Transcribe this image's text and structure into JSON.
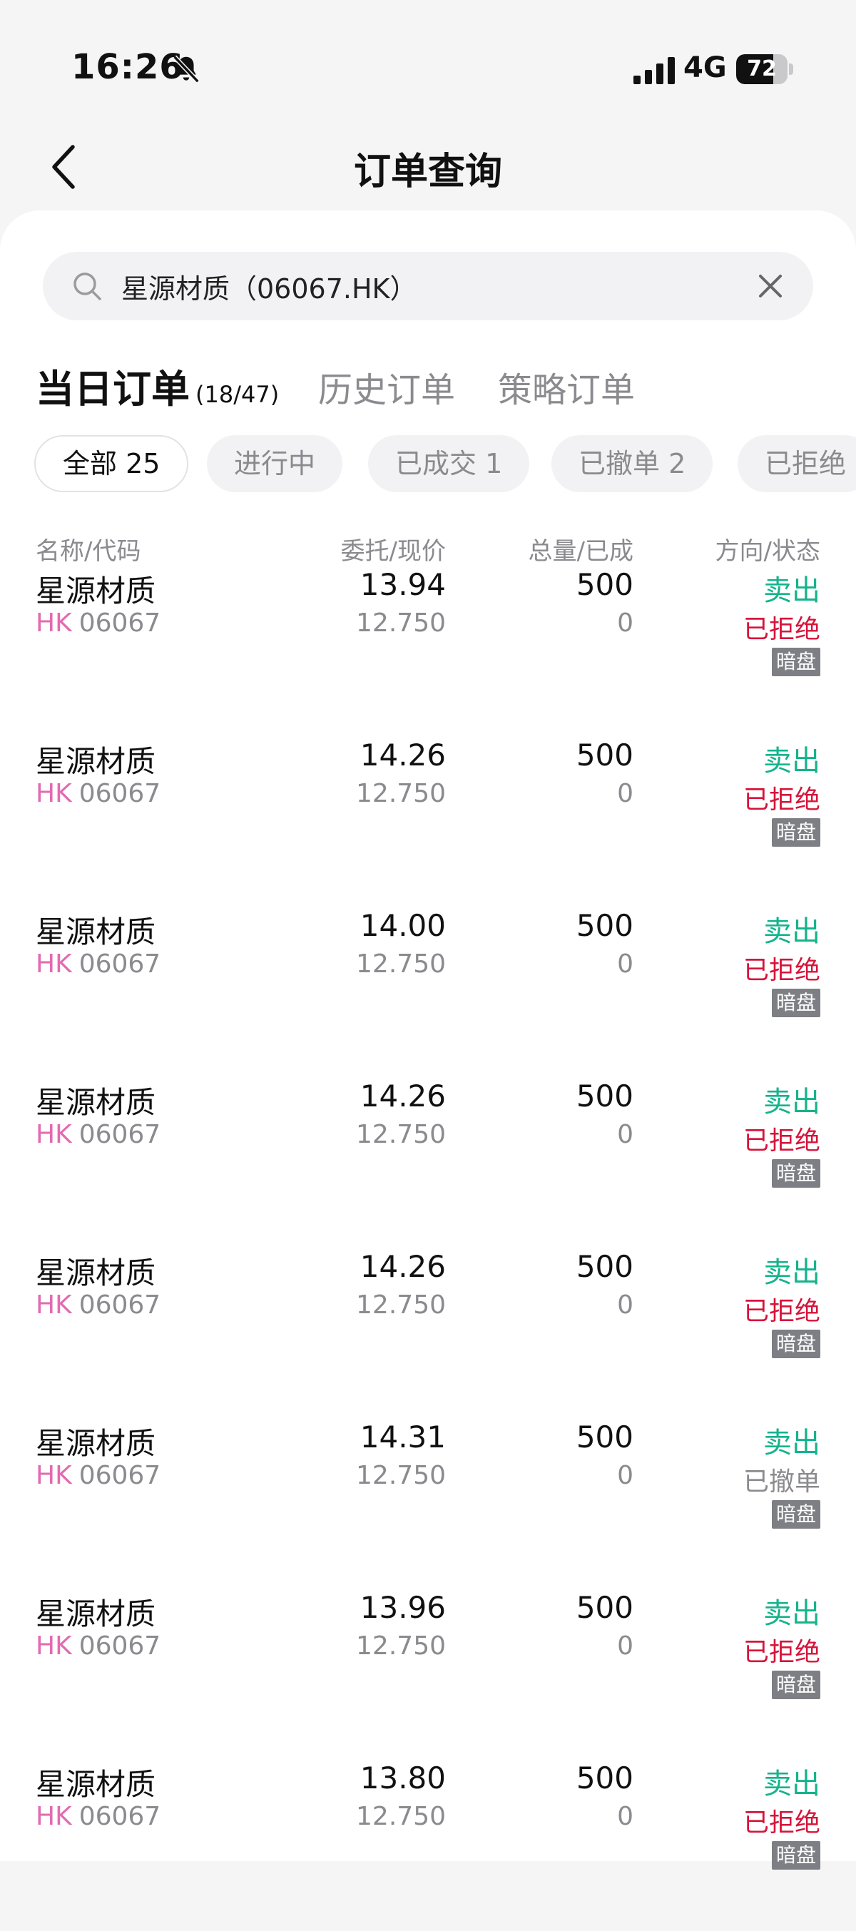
{
  "status_bar": {
    "time": "16:26",
    "network": "4G",
    "battery_level": 72,
    "battery_text": "72"
  },
  "nav": {
    "title": "订单查询"
  },
  "search": {
    "value": "星源材质（06067.HK）"
  },
  "tabs": [
    {
      "label": "当日订单",
      "count": "(18/47)",
      "active": true
    },
    {
      "label": "历史订单",
      "active": false
    },
    {
      "label": "策略订单",
      "active": false
    }
  ],
  "filters": [
    {
      "label": "全部 25",
      "active": true
    },
    {
      "label": "进行中",
      "active": false
    },
    {
      "label": "已成交 1",
      "active": false
    },
    {
      "label": "已撤单 2",
      "active": false
    },
    {
      "label": "已拒绝",
      "active": false
    }
  ],
  "columns": {
    "name": "名称/代码",
    "price": "委托/现价",
    "qty": "总量/已成",
    "direction": "方向/状态"
  },
  "orders": [
    {
      "name": "星源材质",
      "market": "HK",
      "code": "06067",
      "price": "13.94",
      "current": "12.750",
      "qty": "500",
      "filled": "0",
      "direction": "卖出",
      "status": "已拒绝",
      "status_type": "rejected",
      "tag": "暗盘"
    },
    {
      "name": "星源材质",
      "market": "HK",
      "code": "06067",
      "price": "14.26",
      "current": "12.750",
      "qty": "500",
      "filled": "0",
      "direction": "卖出",
      "status": "已拒绝",
      "status_type": "rejected",
      "tag": "暗盘"
    },
    {
      "name": "星源材质",
      "market": "HK",
      "code": "06067",
      "price": "14.00",
      "current": "12.750",
      "qty": "500",
      "filled": "0",
      "direction": "卖出",
      "status": "已拒绝",
      "status_type": "rejected",
      "tag": "暗盘"
    },
    {
      "name": "星源材质",
      "market": "HK",
      "code": "06067",
      "price": "14.26",
      "current": "12.750",
      "qty": "500",
      "filled": "0",
      "direction": "卖出",
      "status": "已拒绝",
      "status_type": "rejected",
      "tag": "暗盘"
    },
    {
      "name": "星源材质",
      "market": "HK",
      "code": "06067",
      "price": "14.26",
      "current": "12.750",
      "qty": "500",
      "filled": "0",
      "direction": "卖出",
      "status": "已拒绝",
      "status_type": "rejected",
      "tag": "暗盘"
    },
    {
      "name": "星源材质",
      "market": "HK",
      "code": "06067",
      "price": "14.31",
      "current": "12.750",
      "qty": "500",
      "filled": "0",
      "direction": "卖出",
      "status": "已撤单",
      "status_type": "cancelled",
      "tag": "暗盘"
    },
    {
      "name": "星源材质",
      "market": "HK",
      "code": "06067",
      "price": "13.96",
      "current": "12.750",
      "qty": "500",
      "filled": "0",
      "direction": "卖出",
      "status": "已拒绝",
      "status_type": "rejected",
      "tag": "暗盘"
    },
    {
      "name": "星源材质",
      "market": "HK",
      "code": "06067",
      "price": "13.80",
      "current": "12.750",
      "qty": "500",
      "filled": "0",
      "direction": "卖出",
      "status": "已拒绝",
      "status_type": "rejected",
      "tag": "暗盘"
    }
  ],
  "colors": {
    "sell": "#15b38c",
    "rejected": "#d6143a",
    "market": "#e26bb0",
    "tag_bg": "#7d7f84"
  }
}
